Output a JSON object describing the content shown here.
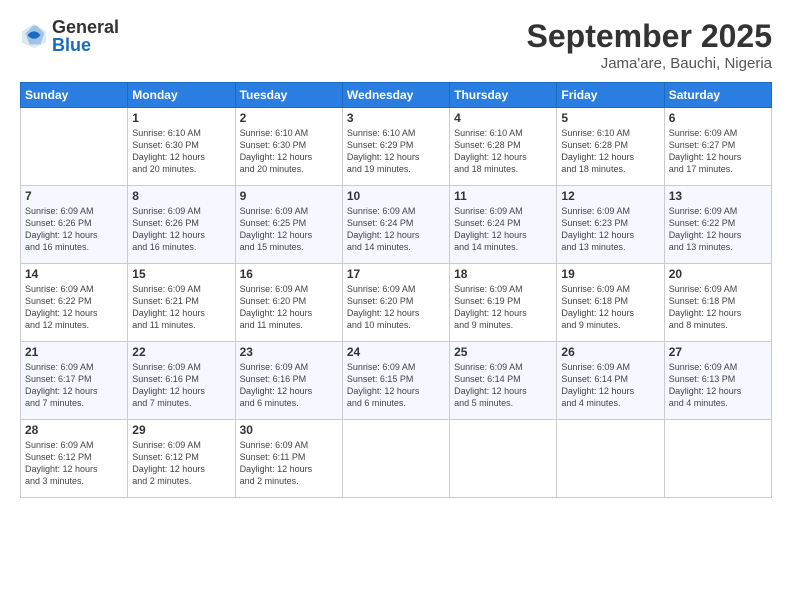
{
  "header": {
    "logo": {
      "general": "General",
      "blue": "Blue"
    },
    "title": "September 2025",
    "subtitle": "Jama'are, Bauchi, Nigeria"
  },
  "columns": [
    "Sunday",
    "Monday",
    "Tuesday",
    "Wednesday",
    "Thursday",
    "Friday",
    "Saturday"
  ],
  "weeks": [
    [
      {
        "day": "",
        "info": ""
      },
      {
        "day": "1",
        "info": "Sunrise: 6:10 AM\nSunset: 6:30 PM\nDaylight: 12 hours\nand 20 minutes."
      },
      {
        "day": "2",
        "info": "Sunrise: 6:10 AM\nSunset: 6:30 PM\nDaylight: 12 hours\nand 20 minutes."
      },
      {
        "day": "3",
        "info": "Sunrise: 6:10 AM\nSunset: 6:29 PM\nDaylight: 12 hours\nand 19 minutes."
      },
      {
        "day": "4",
        "info": "Sunrise: 6:10 AM\nSunset: 6:28 PM\nDaylight: 12 hours\nand 18 minutes."
      },
      {
        "day": "5",
        "info": "Sunrise: 6:10 AM\nSunset: 6:28 PM\nDaylight: 12 hours\nand 18 minutes."
      },
      {
        "day": "6",
        "info": "Sunrise: 6:09 AM\nSunset: 6:27 PM\nDaylight: 12 hours\nand 17 minutes."
      }
    ],
    [
      {
        "day": "7",
        "info": "Sunrise: 6:09 AM\nSunset: 6:26 PM\nDaylight: 12 hours\nand 16 minutes."
      },
      {
        "day": "8",
        "info": "Sunrise: 6:09 AM\nSunset: 6:26 PM\nDaylight: 12 hours\nand 16 minutes."
      },
      {
        "day": "9",
        "info": "Sunrise: 6:09 AM\nSunset: 6:25 PM\nDaylight: 12 hours\nand 15 minutes."
      },
      {
        "day": "10",
        "info": "Sunrise: 6:09 AM\nSunset: 6:24 PM\nDaylight: 12 hours\nand 14 minutes."
      },
      {
        "day": "11",
        "info": "Sunrise: 6:09 AM\nSunset: 6:24 PM\nDaylight: 12 hours\nand 14 minutes."
      },
      {
        "day": "12",
        "info": "Sunrise: 6:09 AM\nSunset: 6:23 PM\nDaylight: 12 hours\nand 13 minutes."
      },
      {
        "day": "13",
        "info": "Sunrise: 6:09 AM\nSunset: 6:22 PM\nDaylight: 12 hours\nand 13 minutes."
      }
    ],
    [
      {
        "day": "14",
        "info": "Sunrise: 6:09 AM\nSunset: 6:22 PM\nDaylight: 12 hours\nand 12 minutes."
      },
      {
        "day": "15",
        "info": "Sunrise: 6:09 AM\nSunset: 6:21 PM\nDaylight: 12 hours\nand 11 minutes."
      },
      {
        "day": "16",
        "info": "Sunrise: 6:09 AM\nSunset: 6:20 PM\nDaylight: 12 hours\nand 11 minutes."
      },
      {
        "day": "17",
        "info": "Sunrise: 6:09 AM\nSunset: 6:20 PM\nDaylight: 12 hours\nand 10 minutes."
      },
      {
        "day": "18",
        "info": "Sunrise: 6:09 AM\nSunset: 6:19 PM\nDaylight: 12 hours\nand 9 minutes."
      },
      {
        "day": "19",
        "info": "Sunrise: 6:09 AM\nSunset: 6:18 PM\nDaylight: 12 hours\nand 9 minutes."
      },
      {
        "day": "20",
        "info": "Sunrise: 6:09 AM\nSunset: 6:18 PM\nDaylight: 12 hours\nand 8 minutes."
      }
    ],
    [
      {
        "day": "21",
        "info": "Sunrise: 6:09 AM\nSunset: 6:17 PM\nDaylight: 12 hours\nand 7 minutes."
      },
      {
        "day": "22",
        "info": "Sunrise: 6:09 AM\nSunset: 6:16 PM\nDaylight: 12 hours\nand 7 minutes."
      },
      {
        "day": "23",
        "info": "Sunrise: 6:09 AM\nSunset: 6:16 PM\nDaylight: 12 hours\nand 6 minutes."
      },
      {
        "day": "24",
        "info": "Sunrise: 6:09 AM\nSunset: 6:15 PM\nDaylight: 12 hours\nand 6 minutes."
      },
      {
        "day": "25",
        "info": "Sunrise: 6:09 AM\nSunset: 6:14 PM\nDaylight: 12 hours\nand 5 minutes."
      },
      {
        "day": "26",
        "info": "Sunrise: 6:09 AM\nSunset: 6:14 PM\nDaylight: 12 hours\nand 4 minutes."
      },
      {
        "day": "27",
        "info": "Sunrise: 6:09 AM\nSunset: 6:13 PM\nDaylight: 12 hours\nand 4 minutes."
      }
    ],
    [
      {
        "day": "28",
        "info": "Sunrise: 6:09 AM\nSunset: 6:12 PM\nDaylight: 12 hours\nand 3 minutes."
      },
      {
        "day": "29",
        "info": "Sunrise: 6:09 AM\nSunset: 6:12 PM\nDaylight: 12 hours\nand 2 minutes."
      },
      {
        "day": "30",
        "info": "Sunrise: 6:09 AM\nSunset: 6:11 PM\nDaylight: 12 hours\nand 2 minutes."
      },
      {
        "day": "",
        "info": ""
      },
      {
        "day": "",
        "info": ""
      },
      {
        "day": "",
        "info": ""
      },
      {
        "day": "",
        "info": ""
      }
    ]
  ]
}
